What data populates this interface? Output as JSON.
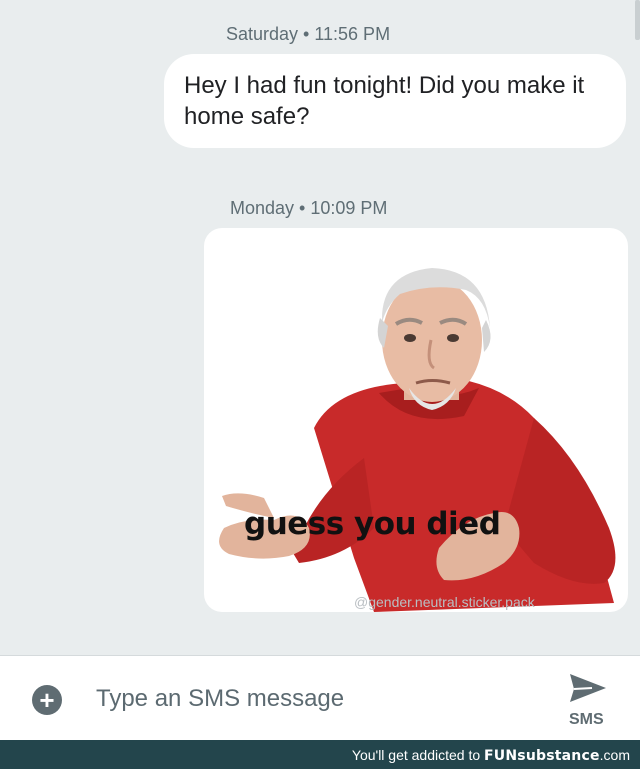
{
  "conversation": {
    "timestamps": [
      "Saturday • 11:56 PM",
      "Monday • 10:09 PM"
    ],
    "messages": [
      {
        "text": "Hey I had fun tonight! Did you make it home safe?"
      }
    ],
    "sticker": {
      "caption": "guess you died",
      "watermark": "@gender.neutral.sticker.pack"
    }
  },
  "composer": {
    "placeholder": "Type an SMS message",
    "send_label": "SMS",
    "attach_icon": "plus-icon",
    "send_icon": "send-arrow-icon"
  },
  "footer": {
    "text": "You'll get addicted to",
    "brand": "FUNsubstance",
    "domain": ".com"
  }
}
